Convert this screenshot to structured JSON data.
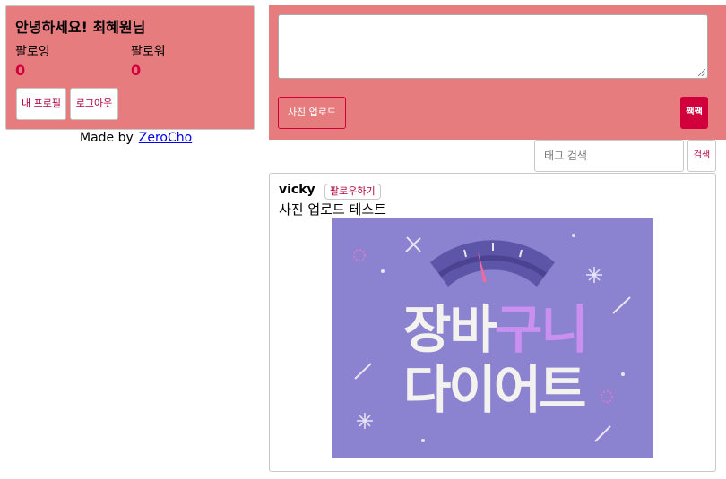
{
  "profile": {
    "greeting": "안녕하세요! 최혜원님",
    "following_label": "팔로잉",
    "following_count": "0",
    "followers_label": "팔로워",
    "followers_count": "0",
    "my_profile_button": "내 프로필",
    "logout_button": "로그아웃"
  },
  "footer": {
    "made_by": "Made by",
    "author_link": "ZeroCho"
  },
  "post_form": {
    "textarea_value": "",
    "upload_button": "사진 업로드",
    "submit_button": "짹짹"
  },
  "search": {
    "placeholder": "태그 검색",
    "button": "검색"
  },
  "posts": [
    {
      "author": "vicky",
      "follow_button": "팔로우하기",
      "content": "사진 업로드 테스트",
      "image": {
        "title_line1_left": "장바",
        "title_line1_right": "구니",
        "title_line2": "다이어트"
      }
    }
  ],
  "colors": {
    "panel_bg": "#e77c7e",
    "accent": "#d1003d",
    "image_bg": "#8b82d0",
    "image_text_white": "#f4f2ef",
    "image_text_purple": "#c990f2"
  }
}
